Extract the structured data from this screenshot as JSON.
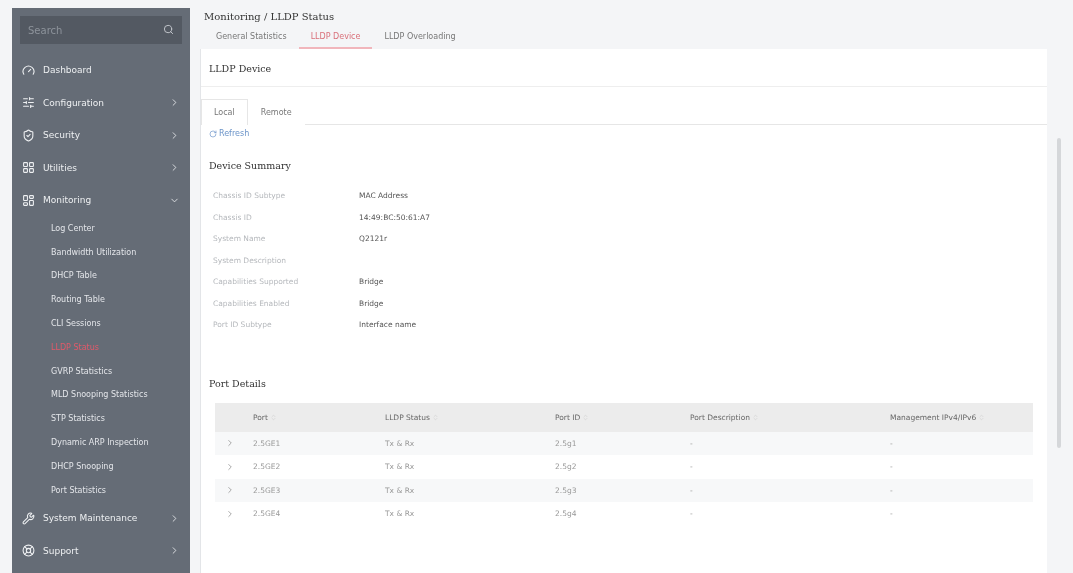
{
  "sidebar": {
    "search": {
      "placeholder": "Search"
    },
    "items": [
      {
        "label": "Dashboard",
        "expandable": false
      },
      {
        "label": "Configuration",
        "expandable": true,
        "expanded": false
      },
      {
        "label": "Security",
        "expandable": true,
        "expanded": false
      },
      {
        "label": "Utilities",
        "expandable": true,
        "expanded": false
      },
      {
        "label": "Monitoring",
        "expandable": true,
        "expanded": true,
        "children": [
          {
            "label": "Log Center",
            "selected": false
          },
          {
            "label": "Bandwidth Utilization",
            "selected": false
          },
          {
            "label": "DHCP Table",
            "selected": false
          },
          {
            "label": "Routing Table",
            "selected": false
          },
          {
            "label": "CLI Sessions",
            "selected": false
          },
          {
            "label": "LLDP Status",
            "selected": true
          },
          {
            "label": "GVRP Statistics",
            "selected": false
          },
          {
            "label": "MLD Snooping Statistics",
            "selected": false
          },
          {
            "label": "STP Statistics",
            "selected": false
          },
          {
            "label": "Dynamic ARP Inspection",
            "selected": false
          },
          {
            "label": "DHCP Snooping",
            "selected": false
          },
          {
            "label": "Port Statistics",
            "selected": false
          }
        ]
      },
      {
        "label": "System Maintenance",
        "expandable": true,
        "expanded": false
      },
      {
        "label": "Support",
        "expandable": true,
        "expanded": false
      }
    ]
  },
  "breadcrumb": "Monitoring / LLDP Status",
  "tabs": [
    {
      "label": "General Statistics",
      "selected": false
    },
    {
      "label": "LLDP Device",
      "selected": true
    },
    {
      "label": "LLDP Overloading",
      "selected": false
    }
  ],
  "card": {
    "title": "LLDP Device",
    "subtabs": [
      {
        "label": "Local",
        "selected": true
      },
      {
        "label": "Remote",
        "selected": false
      }
    ],
    "refresh": "Refresh",
    "summary": {
      "title": "Device Summary",
      "rows": [
        {
          "label": "Chassis ID Subtype",
          "value": "MAC Address"
        },
        {
          "label": "Chassis ID",
          "value": "14:49:BC:50:61:A7"
        },
        {
          "label": "System Name",
          "value": "Q2121r"
        },
        {
          "label": "System Description"
        },
        {
          "label": "Capabilities Supported",
          "value": "Bridge"
        },
        {
          "label": "Capabilities Enabled",
          "value": "Bridge"
        },
        {
          "label": "Port ID Subtype",
          "value": "Interface name"
        }
      ]
    },
    "ports": {
      "title": "Port Details",
      "columns": [
        "Port",
        "LLDP Status",
        "Port ID",
        "Port Description",
        "Management IPv4/IPv6"
      ],
      "rows": [
        [
          "2.5GE1",
          "Tx & Rx",
          "2.5g1",
          "-",
          "-"
        ],
        [
          "2.5GE2",
          "Tx & Rx",
          "2.5g2",
          "-",
          "-"
        ],
        [
          "2.5GE3",
          "Tx & Rx",
          "2.5g3",
          "-",
          "-"
        ],
        [
          "2.5GE4",
          "Tx & Rx",
          "2.5g4",
          "-",
          "-"
        ]
      ]
    }
  }
}
